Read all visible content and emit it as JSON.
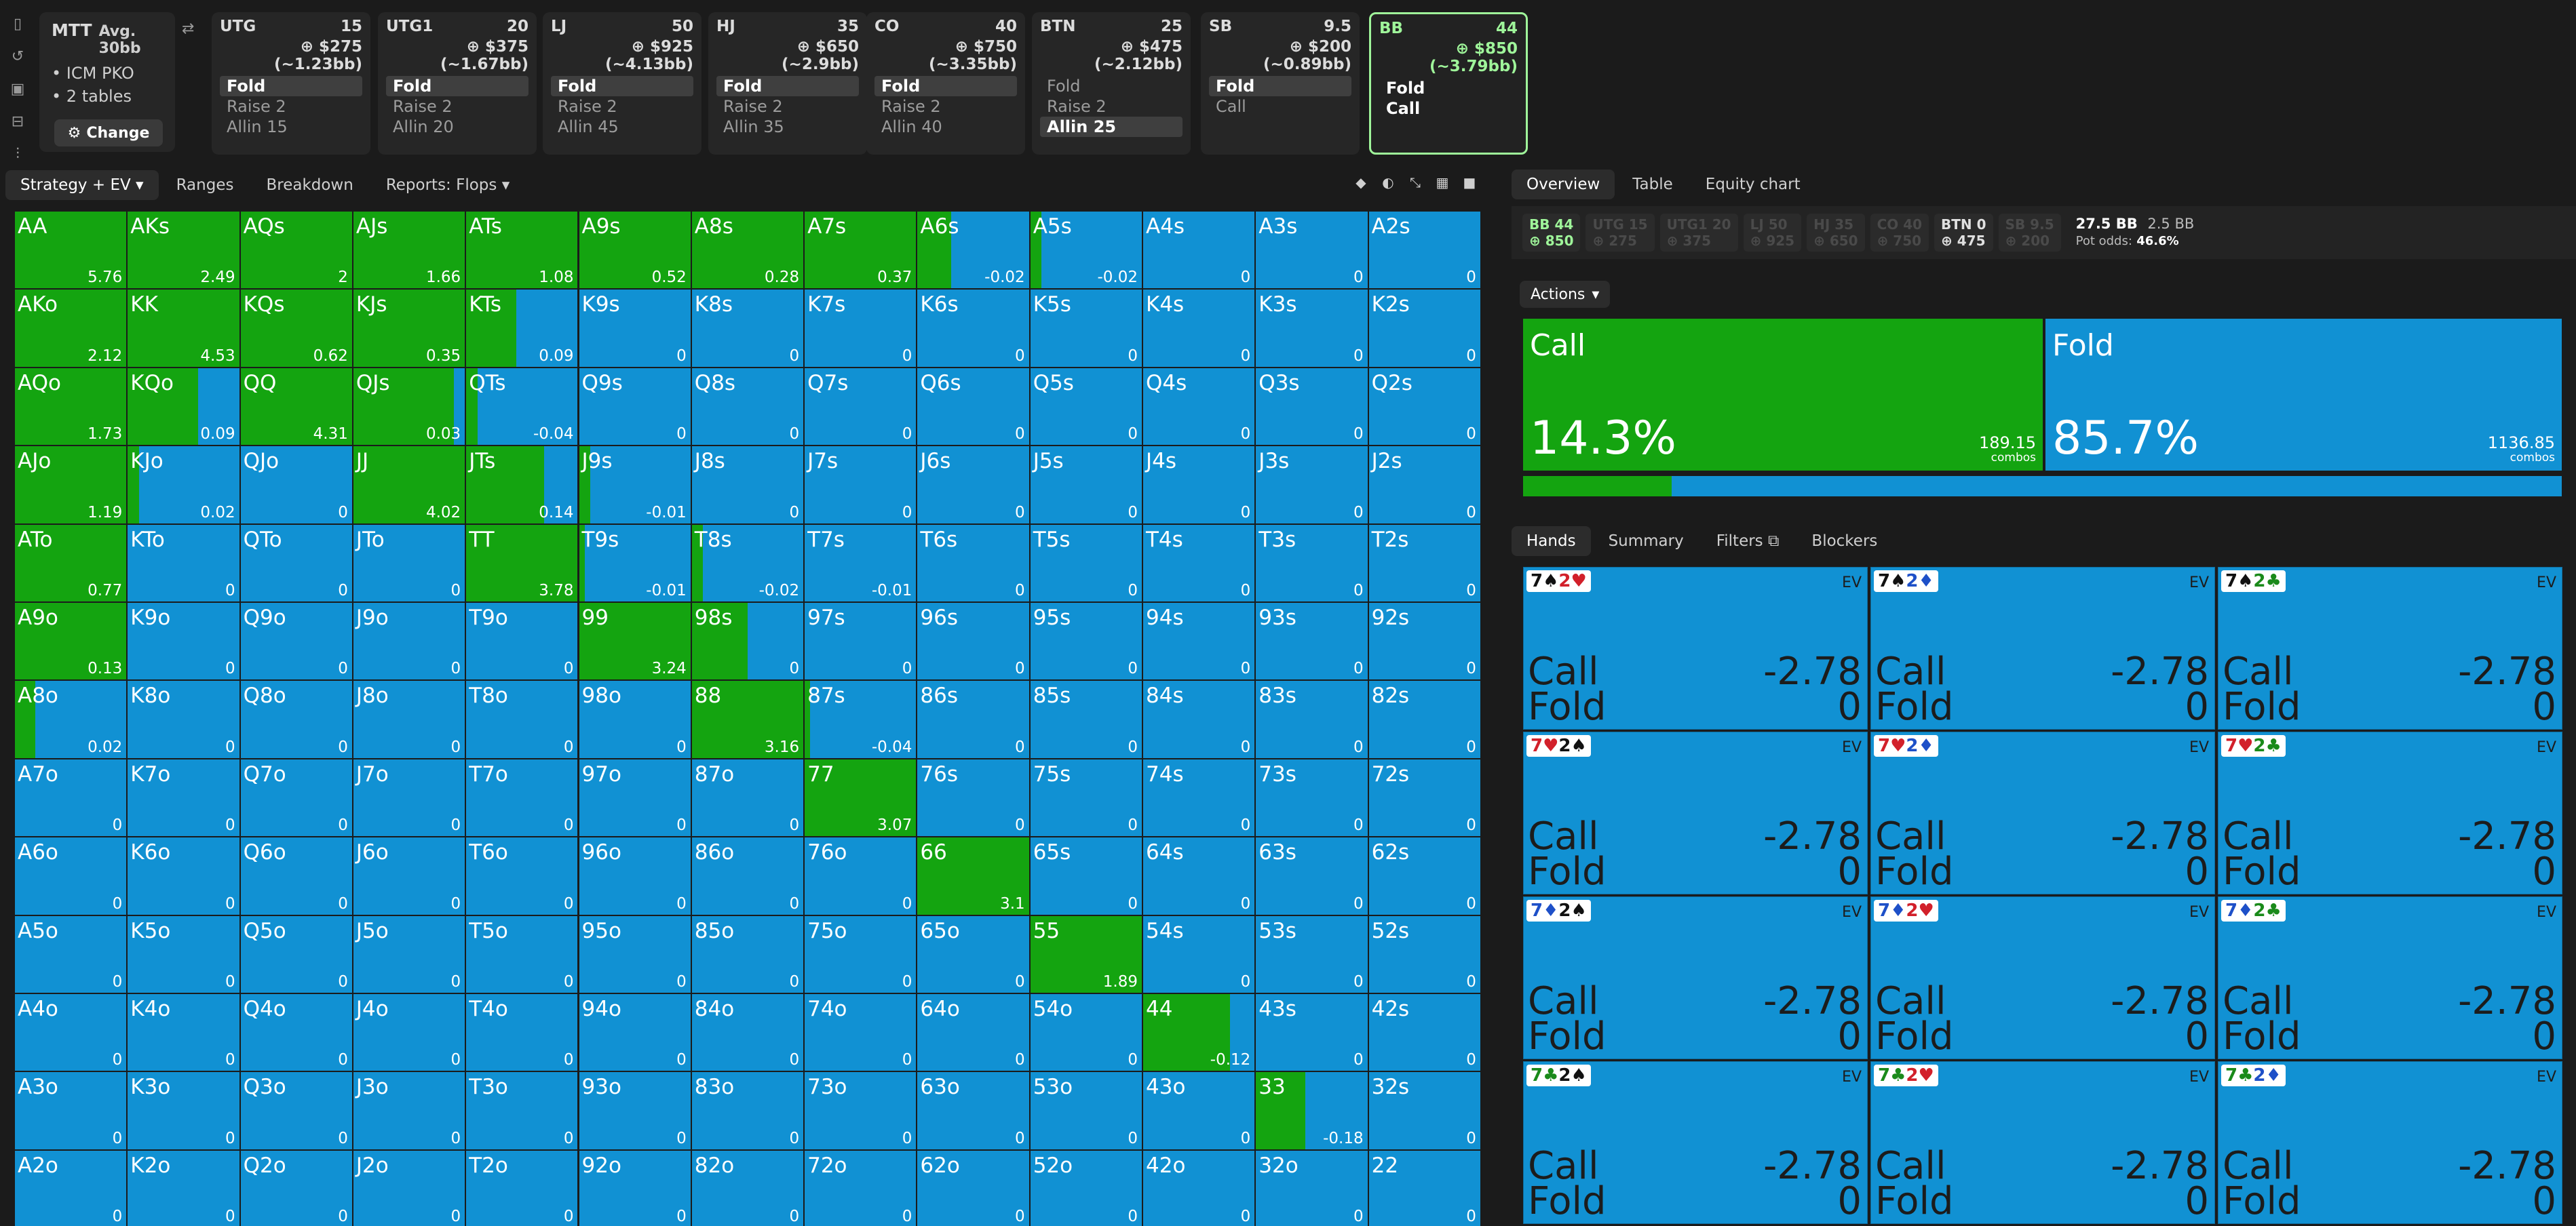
{
  "sidebar_icons": [
    "bookmark-icon",
    "history-icon",
    "save-icon",
    "table-icon",
    "settings-icon"
  ],
  "info": {
    "format": "MTT",
    "avg": "Avg. 30bb",
    "bullets": [
      "ICM PKO",
      "2 tables"
    ],
    "change": "Change"
  },
  "positions": [
    {
      "name": "UTG",
      "bb": "15",
      "chips": "$275 (~1.23bb)",
      "actions": [
        "Fold",
        "Raise 2",
        "Allin 15"
      ],
      "sel": 0
    },
    {
      "name": "UTG1",
      "bb": "20",
      "chips": "$375 (~1.67bb)",
      "actions": [
        "Fold",
        "Raise 2",
        "Allin 20"
      ],
      "sel": 0
    },
    {
      "name": "LJ",
      "bb": "50",
      "chips": "$925 (~4.13bb)",
      "actions": [
        "Fold",
        "Raise 2",
        "Allin 45"
      ],
      "sel": 0
    },
    {
      "name": "HJ",
      "bb": "35",
      "chips": "$650 (~2.9bb)",
      "actions": [
        "Fold",
        "Raise 2",
        "Allin 35"
      ],
      "sel": 0
    },
    {
      "name": "CO",
      "bb": "40",
      "chips": "$750 (~3.35bb)",
      "actions": [
        "Fold",
        "Raise 2",
        "Allin 40"
      ],
      "sel": 0
    },
    {
      "name": "BTN",
      "bb": "25",
      "chips": "$475 (~2.12bb)",
      "actions": [
        "Fold",
        "Raise 2",
        "Allin 25"
      ],
      "sel": 2
    },
    {
      "name": "SB",
      "bb": "9.5",
      "chips": "$200 (~0.89bb)",
      "actions": [
        "Fold",
        "Call"
      ],
      "sel": 0
    },
    {
      "name": "BB",
      "bb": "44",
      "chips": "$850 (~3.79bb)",
      "actions": [
        "Fold",
        "Call"
      ],
      "sel": -1,
      "active": true
    }
  ],
  "left_tabs": [
    "Strategy + EV",
    "Ranges",
    "Breakdown",
    "Reports: Flops"
  ],
  "view_icons": [
    "cube-icon",
    "contrast-icon",
    "compress-icon",
    "grid-icon",
    "square-icon"
  ],
  "colors": {
    "call": "#14a410",
    "fold": "#1191d3"
  },
  "ranks": [
    "A",
    "K",
    "Q",
    "J",
    "T",
    "9",
    "8",
    "7",
    "6",
    "5",
    "4",
    "3",
    "2"
  ],
  "grid": {
    "call_freq": [
      [
        1,
        1,
        1,
        1,
        1,
        1,
        1,
        1,
        0.3,
        0.1,
        0,
        0,
        0
      ],
      [
        1,
        1,
        1,
        1,
        0.45,
        0,
        0,
        0,
        0,
        0,
        0,
        0,
        0
      ],
      [
        1,
        0.63,
        1,
        0.9,
        0.1,
        0,
        0,
        0,
        0,
        0,
        0,
        0,
        0
      ],
      [
        1,
        0.1,
        0,
        1,
        0.7,
        0.1,
        0,
        0,
        0,
        0,
        0,
        0,
        0
      ],
      [
        1,
        0,
        0,
        0,
        1,
        0.05,
        0.1,
        0,
        0,
        0,
        0,
        0,
        0
      ],
      [
        1,
        0,
        0,
        0,
        0,
        1,
        0.5,
        0,
        0,
        0,
        0,
        0,
        0
      ],
      [
        0.18,
        0,
        0,
        0,
        0,
        0,
        1,
        0.05,
        0,
        0,
        0,
        0,
        0
      ],
      [
        0,
        0,
        0,
        0,
        0,
        0,
        0,
        1,
        0,
        0,
        0,
        0,
        0
      ],
      [
        0,
        0,
        0,
        0,
        0,
        0,
        0,
        0,
        1,
        0,
        0,
        0,
        0
      ],
      [
        0,
        0,
        0,
        0,
        0,
        0,
        0,
        0,
        0,
        1,
        0,
        0,
        0
      ],
      [
        0,
        0,
        0,
        0,
        0,
        0,
        0,
        0,
        0,
        0,
        0.78,
        0,
        0
      ],
      [
        0,
        0,
        0,
        0,
        0,
        0,
        0,
        0,
        0,
        0,
        0,
        0.44,
        0
      ],
      [
        0,
        0,
        0,
        0,
        0,
        0,
        0,
        0,
        0,
        0,
        0,
        0,
        0
      ]
    ],
    "ev": [
      [
        "5.76",
        "2.49",
        "2",
        "1.66",
        "1.08",
        "0.52",
        "0.28",
        "0.37",
        "-0.02",
        "-0.02",
        "0",
        "0",
        "0"
      ],
      [
        "2.12",
        "4.53",
        "0.62",
        "0.35",
        "0.09",
        "0",
        "0",
        "0",
        "0",
        "0",
        "0",
        "0",
        "0"
      ],
      [
        "1.73",
        "0.09",
        "4.31",
        "0.03",
        "-0.04",
        "0",
        "0",
        "0",
        "0",
        "0",
        "0",
        "0",
        "0"
      ],
      [
        "1.19",
        "0.02",
        "0",
        "4.02",
        "0.14",
        "-0.01",
        "0",
        "0",
        "0",
        "0",
        "0",
        "0",
        "0"
      ],
      [
        "0.77",
        "0",
        "0",
        "0",
        "3.78",
        "-0.01",
        "-0.02",
        "-0.01",
        "0",
        "0",
        "0",
        "0",
        "0"
      ],
      [
        "0.13",
        "0",
        "0",
        "0",
        "0",
        "3.24",
        "0",
        "0",
        "0",
        "0",
        "0",
        "0",
        "0"
      ],
      [
        "0.02",
        "0",
        "0",
        "0",
        "0",
        "0",
        "3.16",
        "-0.04",
        "0",
        "0",
        "0",
        "0",
        "0"
      ],
      [
        "0",
        "0",
        "0",
        "0",
        "0",
        "0",
        "0",
        "3.07",
        "0",
        "0",
        "0",
        "0",
        "0"
      ],
      [
        "0",
        "0",
        "0",
        "0",
        "0",
        "0",
        "0",
        "0",
        "3.1",
        "0",
        "0",
        "0",
        "0"
      ],
      [
        "0",
        "0",
        "0",
        "0",
        "0",
        "0",
        "0",
        "0",
        "0",
        "1.89",
        "0",
        "0",
        "0"
      ],
      [
        "0",
        "0",
        "0",
        "0",
        "0",
        "0",
        "0",
        "0",
        "0",
        "0",
        "-0.12",
        "0",
        "0"
      ],
      [
        "0",
        "0",
        "0",
        "0",
        "0",
        "0",
        "0",
        "0",
        "0",
        "0",
        "0",
        "-0.18",
        "0"
      ],
      [
        "0",
        "0",
        "0",
        "0",
        "0",
        "0",
        "0",
        "0",
        "0",
        "0",
        "0",
        "0",
        "0"
      ]
    ]
  },
  "right_tabs": [
    "Overview",
    "Table",
    "Equity chart"
  ],
  "stacks": [
    {
      "n": "BB 44",
      "c": "850",
      "cls": "hero"
    },
    {
      "n": "UTG 15",
      "c": "275",
      "cls": ""
    },
    {
      "n": "UTG1 20",
      "c": "375",
      "cls": ""
    },
    {
      "n": "LJ 50",
      "c": "925",
      "cls": ""
    },
    {
      "n": "HJ 35",
      "c": "650",
      "cls": ""
    },
    {
      "n": "CO 40",
      "c": "750",
      "cls": ""
    },
    {
      "n": "BTN 0",
      "c": "475",
      "cls": "live"
    },
    {
      "n": "SB 9.5",
      "c": "200",
      "cls": ""
    }
  ],
  "pot": {
    "bb": "27.5 BB",
    "bb2": "2.5 BB",
    "odds_label": "Pot odds:",
    "odds": "46.6%"
  },
  "actions_label": "Actions",
  "summary": {
    "call": {
      "label": "Call",
      "pct": "14.3%",
      "combos": "189.15",
      "unit": "combos",
      "freq": 0.143
    },
    "fold": {
      "label": "Fold",
      "pct": "85.7%",
      "combos": "1136.85",
      "unit": "combos",
      "freq": 0.857
    }
  },
  "hand_tabs": [
    "Hands",
    "Summary",
    "Filters",
    "Blockers"
  ],
  "hands_ev_label": "EV",
  "hands": [
    {
      "c1": "7♠",
      "c1c": "k",
      "c2": "2♥",
      "c2c": "r",
      "call": "-2.78",
      "fold": "0"
    },
    {
      "c1": "7♠",
      "c1c": "k",
      "c2": "2♦",
      "c2c": "b",
      "call": "-2.78",
      "fold": "0"
    },
    {
      "c1": "7♠",
      "c1c": "k",
      "c2": "2♣",
      "c2c": "gr",
      "call": "-2.78",
      "fold": "0"
    },
    {
      "c1": "7♥",
      "c1c": "r",
      "c2": "2♠",
      "c2c": "k",
      "call": "-2.78",
      "fold": "0"
    },
    {
      "c1": "7♥",
      "c1c": "r",
      "c2": "2♦",
      "c2c": "b",
      "call": "-2.78",
      "fold": "0"
    },
    {
      "c1": "7♥",
      "c1c": "r",
      "c2": "2♣",
      "c2c": "gr",
      "call": "-2.78",
      "fold": "0"
    },
    {
      "c1": "7♦",
      "c1c": "b",
      "c2": "2♠",
      "c2c": "k",
      "call": "-2.78",
      "fold": "0"
    },
    {
      "c1": "7♦",
      "c1c": "b",
      "c2": "2♥",
      "c2c": "r",
      "call": "-2.78",
      "fold": "0"
    },
    {
      "c1": "7♦",
      "c1c": "b",
      "c2": "2♣",
      "c2c": "gr",
      "call": "-2.78",
      "fold": "0"
    },
    {
      "c1": "7♣",
      "c1c": "gr",
      "c2": "2♠",
      "c2c": "k",
      "call": "-2.78",
      "fold": "0"
    },
    {
      "c1": "7♣",
      "c1c": "gr",
      "c2": "2♥",
      "c2c": "r",
      "call": "-2.78",
      "fold": "0"
    },
    {
      "c1": "7♣",
      "c1c": "gr",
      "c2": "2♦",
      "c2c": "b",
      "call": "-2.78",
      "fold": "0"
    }
  ],
  "call_label": "Call",
  "fold_label": "Fold"
}
